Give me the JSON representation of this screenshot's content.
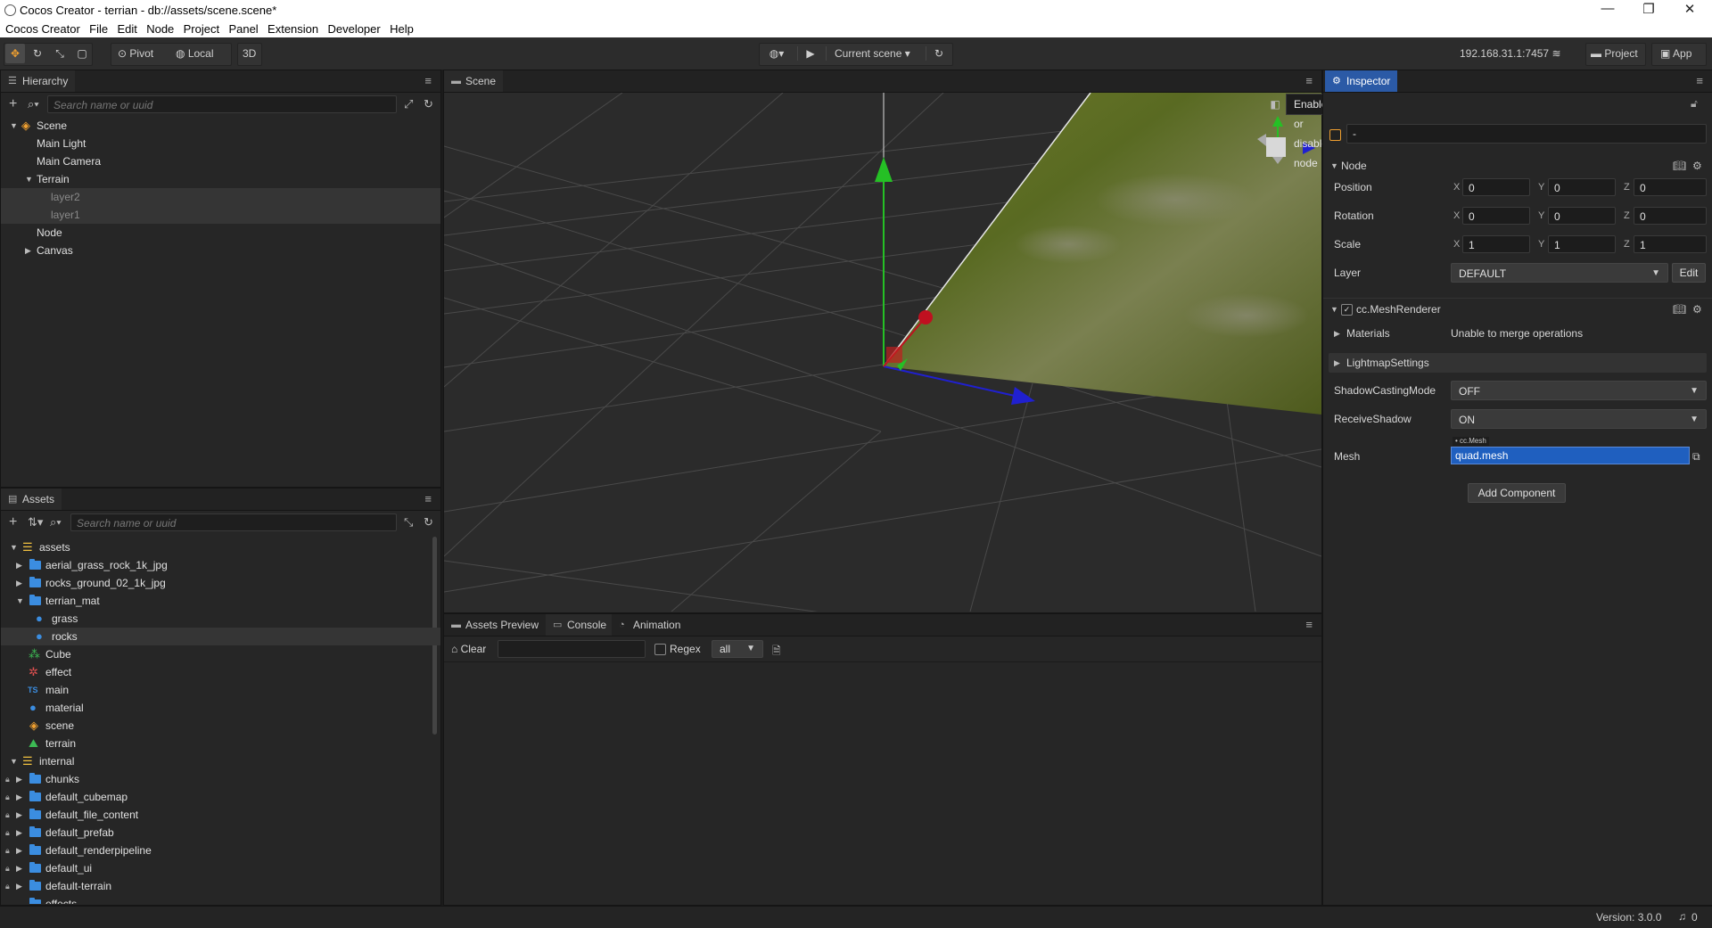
{
  "window": {
    "title": "Cocos Creator - terrian - db://assets/scene.scene*",
    "controls": [
      "—",
      "❐",
      "✕"
    ]
  },
  "menubar": [
    "Cocos Creator",
    "File",
    "Edit",
    "Node",
    "Project",
    "Panel",
    "Extension",
    "Developer",
    "Help"
  ],
  "toolbar": {
    "pivot": "Pivot",
    "local": "Local",
    "mode3d": "3D",
    "current_scene": "Current scene",
    "ip": "192.168.31.1:7457",
    "project": "Project",
    "app": "App"
  },
  "hierarchy": {
    "title": "Hierarchy",
    "search_placeholder": "Search name or uuid",
    "items": [
      {
        "label": "Scene"
      },
      {
        "label": "Main Light"
      },
      {
        "label": "Main Camera"
      },
      {
        "label": "Terrain"
      },
      {
        "label": "layer2"
      },
      {
        "label": "layer1"
      },
      {
        "label": "Node"
      },
      {
        "label": "Canvas"
      }
    ]
  },
  "assets": {
    "title": "Assets",
    "search_placeholder": "Search name or uuid",
    "items": [
      {
        "label": "assets"
      },
      {
        "label": "aerial_grass_rock_1k_jpg"
      },
      {
        "label": "rocks_ground_02_1k_jpg"
      },
      {
        "label": "terrian_mat"
      },
      {
        "label": "grass"
      },
      {
        "label": "rocks"
      },
      {
        "label": "Cube"
      },
      {
        "label": "effect"
      },
      {
        "label": "main"
      },
      {
        "label": "material"
      },
      {
        "label": "scene"
      },
      {
        "label": "terrain"
      },
      {
        "label": "internal"
      },
      {
        "label": "chunks"
      },
      {
        "label": "default_cubemap"
      },
      {
        "label": "default_file_content"
      },
      {
        "label": "default_prefab"
      },
      {
        "label": "default_renderpipeline"
      },
      {
        "label": "default_ui"
      },
      {
        "label": "default-terrain"
      },
      {
        "label": "effects"
      }
    ],
    "ts_badge": "TS"
  },
  "scene": {
    "title": "Scene",
    "tooltip": "Enable or disable node"
  },
  "console": {
    "tabs": [
      "Assets Preview",
      "Console",
      "Animation"
    ],
    "clear": "Clear",
    "regex": "Regex",
    "filter": "all"
  },
  "inspector": {
    "title": "Inspector",
    "node_name": "-",
    "node_section": "Node",
    "position": {
      "label": "Position",
      "x": "0",
      "y": "0",
      "z": "0"
    },
    "rotation": {
      "label": "Rotation",
      "x": "0",
      "y": "0",
      "z": "0"
    },
    "scale": {
      "label": "Scale",
      "x": "1",
      "y": "1",
      "z": "1"
    },
    "layer": {
      "label": "Layer",
      "value": "DEFAULT",
      "edit": "Edit"
    },
    "axes": [
      "X",
      "Y",
      "Z"
    ],
    "component": "cc.MeshRenderer",
    "materials": {
      "label": "Materials",
      "value": "Unable to merge operations"
    },
    "lightmap": "LightmapSettings",
    "shadow_casting": {
      "label": "ShadowCastingMode",
      "value": "OFF"
    },
    "receive_shadow": {
      "label": "ReceiveShadow",
      "value": "ON"
    },
    "mesh": {
      "label": "Mesh",
      "type": "cc.Mesh",
      "value": "quad.mesh"
    },
    "add_component": "Add Component"
  },
  "status": {
    "version": "Version: 3.0.0",
    "notifications": "0"
  },
  "colors": {
    "accent": "#2b5aa6",
    "folder": "#3b8de0",
    "axis_x": "#2020d0",
    "axis_y": "#20c020",
    "axis_z": "#c01020"
  }
}
